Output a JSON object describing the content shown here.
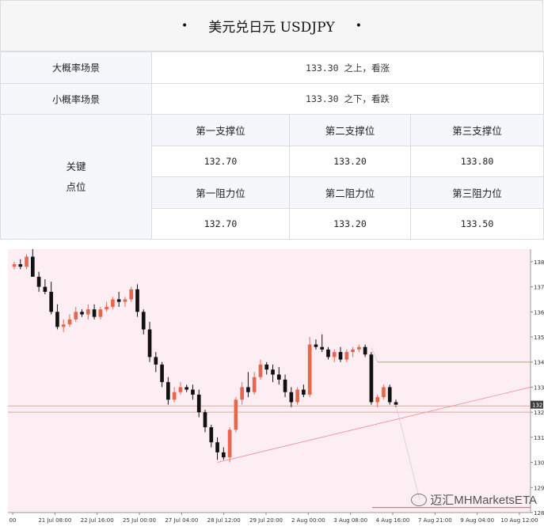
{
  "header": {
    "title": "美元兑日元 USDJPY",
    "bullet": "•"
  },
  "scenarios": [
    {
      "label": "大概率场景",
      "value": "133.30 之上，看涨"
    },
    {
      "label": "小概率场景",
      "value": "133.30 之下，看跌"
    }
  ],
  "key_levels": {
    "label_line1": "关键",
    "label_line2": "点位",
    "support_headers": [
      "第一支撑位",
      "第二支撑位",
      "第三支撑位"
    ],
    "support_values": [
      "132.70",
      "133.20",
      "133.80"
    ],
    "resistance_headers": [
      "第一阻力位",
      "第二阻力位",
      "第三阻力位"
    ],
    "resistance_values": [
      "132.70",
      "133.20",
      "133.50"
    ]
  },
  "watermark": "迈汇MHMarketsETA",
  "colors": {
    "up": "#e8664e",
    "down": "#111111",
    "bg_chart": "#fdeef3",
    "resistance_line": "#a8b84a",
    "support_line": "#e45a5a"
  },
  "chart_data": {
    "type": "candlestick",
    "ylim": [
      128.0,
      138.5
    ],
    "yticks": [
      138,
      137,
      136,
      135,
      134,
      133,
      132,
      131,
      130,
      129,
      128
    ],
    "ytick_labels": [
      "138.",
      "137.",
      "136.",
      "135.",
      "134.",
      "133.",
      "132.",
      "131.",
      "130.",
      "129.",
      "128."
    ],
    "xticks": [
      "00",
      "21 Jul 08:00",
      "22 Jul 16:00",
      "25 Jul 00:00",
      "27 Jul 04:00",
      "28 Jul 12:00",
      "29 Jul 20:00",
      "2 Aug 00:00",
      "3 Aug 08:00",
      "4 Aug 16:00",
      "7 Aug 21:00",
      "9 Aug 04:00",
      "10 Aug 12:00"
    ],
    "current_price_label": "132",
    "candles": [
      [
        137.8,
        138.0,
        137.7,
        137.9
      ],
      [
        137.9,
        138.1,
        137.7,
        137.8
      ],
      [
        137.8,
        138.3,
        137.7,
        138.2
      ],
      [
        138.2,
        138.5,
        137.6,
        137.4
      ],
      [
        137.4,
        137.6,
        136.8,
        137.0
      ],
      [
        137.0,
        137.3,
        136.7,
        136.8
      ],
      [
        136.8,
        137.2,
        135.9,
        136.0
      ],
      [
        136.0,
        136.3,
        135.3,
        135.4
      ],
      [
        135.4,
        135.7,
        135.2,
        135.5
      ],
      [
        135.5,
        135.9,
        135.4,
        135.7
      ],
      [
        135.7,
        136.2,
        135.6,
        136.0
      ],
      [
        136.0,
        136.1,
        135.8,
        135.9
      ],
      [
        135.9,
        136.3,
        135.7,
        136.1
      ],
      [
        136.1,
        136.3,
        135.7,
        135.8
      ],
      [
        135.8,
        136.2,
        135.7,
        136.1
      ],
      [
        136.1,
        136.4,
        136.0,
        136.2
      ],
      [
        136.2,
        136.6,
        136.1,
        136.5
      ],
      [
        136.5,
        136.8,
        136.2,
        136.4
      ],
      [
        136.4,
        136.6,
        136.2,
        136.5
      ],
      [
        136.5,
        137.0,
        136.4,
        136.9
      ],
      [
        136.9,
        137.1,
        135.8,
        136.0
      ],
      [
        136.0,
        136.1,
        135.1,
        135.3
      ],
      [
        135.3,
        135.6,
        134.0,
        134.2
      ],
      [
        134.2,
        134.4,
        133.6,
        133.9
      ],
      [
        133.9,
        134.0,
        133.0,
        133.2
      ],
      [
        133.2,
        133.4,
        132.3,
        132.5
      ],
      [
        132.5,
        133.0,
        132.4,
        132.8
      ],
      [
        132.8,
        133.2,
        132.7,
        133.0
      ],
      [
        133.0,
        133.1,
        132.8,
        132.9
      ],
      [
        132.9,
        133.1,
        132.5,
        132.7
      ],
      [
        132.7,
        132.9,
        131.8,
        132.0
      ],
      [
        132.0,
        132.1,
        131.2,
        131.4
      ],
      [
        131.4,
        131.5,
        130.6,
        130.8
      ],
      [
        130.8,
        131.0,
        130.1,
        130.4
      ],
      [
        130.4,
        130.6,
        130.1,
        130.2
      ],
      [
        130.2,
        131.4,
        130.0,
        131.3
      ],
      [
        131.3,
        132.6,
        131.2,
        132.5
      ],
      [
        132.5,
        133.2,
        132.3,
        133.0
      ],
      [
        133.0,
        133.6,
        132.6,
        132.8
      ],
      [
        132.8,
        133.6,
        132.7,
        133.4
      ],
      [
        133.4,
        134.1,
        133.3,
        133.9
      ],
      [
        133.9,
        134.0,
        133.5,
        133.7
      ],
      [
        133.7,
        133.9,
        133.2,
        133.5
      ],
      [
        133.5,
        133.8,
        133.1,
        133.3
      ],
      [
        133.3,
        133.5,
        132.6,
        132.8
      ],
      [
        132.8,
        133.0,
        132.2,
        132.4
      ],
      [
        132.4,
        133.0,
        132.3,
        132.9
      ],
      [
        132.9,
        133.1,
        132.6,
        132.7
      ],
      [
        132.7,
        135.0,
        132.6,
        134.7
      ],
      [
        134.7,
        134.9,
        134.5,
        134.6
      ],
      [
        134.6,
        135.1,
        134.4,
        134.5
      ],
      [
        134.5,
        134.6,
        134.1,
        134.2
      ],
      [
        134.2,
        134.5,
        134.0,
        134.4
      ],
      [
        134.4,
        134.6,
        134.0,
        134.1
      ],
      [
        134.1,
        134.5,
        134.0,
        134.4
      ],
      [
        134.4,
        134.6,
        134.2,
        134.5
      ],
      [
        134.5,
        134.7,
        134.4,
        134.6
      ],
      [
        134.6,
        134.7,
        134.2,
        134.3
      ],
      [
        134.3,
        134.4,
        132.3,
        132.4
      ],
      [
        132.4,
        132.7,
        132.2,
        132.6
      ],
      [
        132.6,
        133.1,
        132.5,
        133.0
      ],
      [
        133.0,
        133.1,
        132.3,
        132.4
      ],
      [
        132.4,
        132.5,
        132.2,
        132.3
      ]
    ],
    "lines": {
      "resistance": 134.0,
      "support": 127.0
    }
  }
}
